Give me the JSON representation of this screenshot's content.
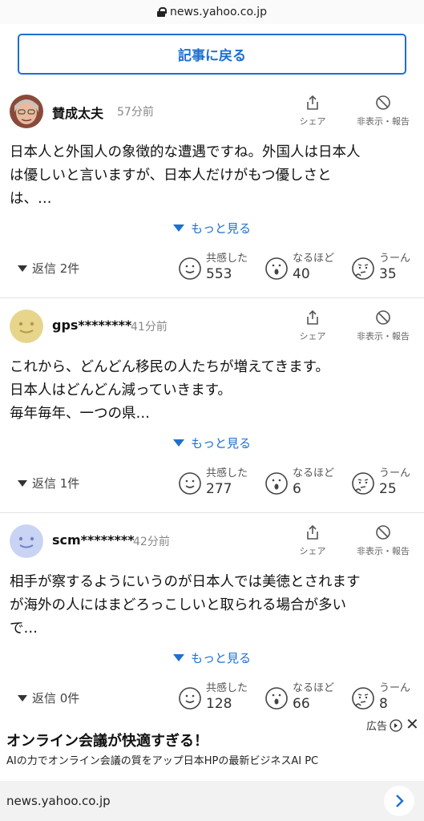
{
  "browser": {
    "url": "news.yahoo.co.jp",
    "bottom_url": "news.yahoo.co.jp"
  },
  "back_button": {
    "label": "記事に戻る"
  },
  "actions": {
    "share_label": "シェア",
    "hide_label": "非表示・報告"
  },
  "more_label": "もっと見る",
  "reactions_labels": {
    "empathy": "共感した",
    "insight": "なるほど",
    "hmm": "うーん"
  },
  "comments": [
    {
      "user": "賛成太夫",
      "time": "57分前",
      "lines": [
        "日本人と外国人の象徴的な遭遇ですね。外国人は日本人",
        "は優しいと言いますが、日本人だけがもつ優しさと",
        "は、…"
      ],
      "replies": "返信 2件",
      "empathy": "553",
      "insight": "40",
      "hmm": "35"
    },
    {
      "user": "gps********",
      "time": "41分前",
      "lines": [
        "これから、どんどん移民の人たちが増えてきます。",
        "日本人はどんどん減っていきます。",
        "毎年毎年、一つの県…"
      ],
      "replies": "返信 1件",
      "empathy": "277",
      "insight": "6",
      "hmm": "25"
    },
    {
      "user": "scm********",
      "time": "42分前",
      "lines": [
        "相手が察するようにいうのが日本人では美徳とされます",
        "が海外の人にはまどろっこしいと取られる場合が多い",
        "で…"
      ],
      "replies": "返信 0件",
      "empathy": "128",
      "insight": "66",
      "hmm": "8"
    }
  ],
  "ad": {
    "label": "広告",
    "title": "オンライン会議が快適すぎる！",
    "description": "AIの力でオンライン会議の質をアップ日本HPの最新ビジネスAI PC"
  },
  "colors": {
    "accent": "#1e6fd0",
    "avatar2": "#e7d58c",
    "avatar3": "#c9d3f3"
  }
}
